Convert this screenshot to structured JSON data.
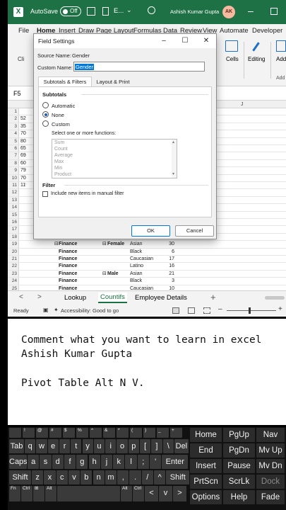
{
  "titlebar": {
    "autosave_label": "AutoSave",
    "autosave_state": "Off",
    "file_short": "E...",
    "user_name": "Ashish Kumar Gupta",
    "user_initials": "AK"
  },
  "ribbon": {
    "tabs": [
      "File",
      "Home",
      "Insert",
      "Draw",
      "Page Layout",
      "Formulas",
      "Data",
      "Review",
      "View",
      "Automate",
      "Developer"
    ],
    "active_tab": "Home",
    "clip_label": "Cli",
    "cells_label": "Cells",
    "editing_label": "Editing",
    "add_label": "Add",
    "add_group_label": "Add"
  },
  "formula_bar": {
    "cell_ref": "F5"
  },
  "grid": {
    "col_j": "J",
    "row_numbers": [
      "1",
      "2",
      "3",
      "4",
      "5",
      "6",
      "7",
      "8",
      "9",
      "10",
      "11",
      "12",
      "13",
      "14",
      "15",
      "16",
      "17",
      "18",
      "19",
      "20",
      "21",
      "22",
      "23",
      "24",
      "25"
    ],
    "left_partial": [
      "",
      "52",
      "35",
      "70",
      "80",
      "65",
      "69",
      "60",
      "79",
      "70",
      "119",
      "",
      "",
      "",
      "",
      "",
      "",
      "",
      "",
      "",
      "",
      "",
      "",
      "",
      ""
    ],
    "rows": [
      {
        "n": "19",
        "dept": "Finance",
        "gender": "Female",
        "ethnicity": "Asian",
        "count": "30",
        "dept_box": true,
        "gender_box": true
      },
      {
        "n": "20",
        "dept": "Finance",
        "gender": "",
        "ethnicity": "Black",
        "count": "6"
      },
      {
        "n": "21",
        "dept": "Finance",
        "gender": "",
        "ethnicity": "Caucasian",
        "count": "17"
      },
      {
        "n": "22",
        "dept": "Finance",
        "gender": "",
        "ethnicity": "Latino",
        "count": "16"
      },
      {
        "n": "23",
        "dept": "Finance",
        "gender": "Male",
        "ethnicity": "Asian",
        "count": "21",
        "gender_box": true
      },
      {
        "n": "24",
        "dept": "Finance",
        "gender": "",
        "ethnicity": "Black",
        "count": "3"
      },
      {
        "n": "25",
        "dept": "Finance",
        "gender": "",
        "ethnicity": "Caucasian",
        "count": "10"
      }
    ]
  },
  "sheet_tabs": {
    "items": [
      "Lookup",
      "Countifs",
      "Employee Details"
    ],
    "active": "Countifs",
    "add": "+"
  },
  "statusbar": {
    "ready": "Ready",
    "accessibility": "Accessibility: Good to go"
  },
  "dialog": {
    "title": "Field Settings",
    "source_name_label": "Source Name:",
    "source_name_value": "Gender",
    "custom_name_label": "Custom Name:",
    "custom_name_value": "Gender",
    "tab_subtotals": "Subtotals & Filters",
    "tab_layout": "Layout & Print",
    "subtotals_heading": "Subtotals",
    "opt_automatic": "Automatic",
    "opt_none": "None",
    "opt_custom": "Custom",
    "selected_option": "None",
    "functions_label": "Select one or more functions:",
    "functions": [
      "Sum",
      "Count",
      "Average",
      "Max",
      "Min",
      "Product"
    ],
    "filter_heading": "Filter",
    "include_new_items": "Include new items in manual filter",
    "ok": "OK",
    "cancel": "Cancel"
  },
  "notes": {
    "line1": "Comment what you want to learn in excel",
    "line2": "Ashish Kumar Gupta",
    "line3": "Pivot Table Alt N V."
  },
  "keyboard": {
    "row1_small": [
      "",
      "!",
      "@",
      "#",
      "$",
      "%",
      "^",
      "&",
      "*",
      "(",
      ")",
      "_",
      "+"
    ],
    "row2": [
      "Tab",
      "q",
      "w",
      "e",
      "r",
      "t",
      "y",
      "u",
      "i",
      "o",
      "p",
      "[",
      "]",
      "\\",
      "Del"
    ],
    "row3": [
      "Caps",
      "a",
      "s",
      "d",
      "f",
      "g",
      "h",
      "j",
      "k",
      "l",
      ";",
      "'",
      "Enter"
    ],
    "row4": [
      "Shift",
      "z",
      "x",
      "c",
      "v",
      "b",
      "n",
      "m",
      ",",
      ".",
      "/",
      "^",
      "Shift"
    ],
    "row5": [
      "Fn",
      "Ctrl",
      "⊞",
      "Alt",
      "",
      "Alt",
      "Ctrl",
      "<",
      "v",
      ">"
    ],
    "nav": [
      [
        "Home",
        "PgUp",
        "Nav"
      ],
      [
        "End",
        "PgDn",
        "Mv Up"
      ],
      [
        "Insert",
        "Pause",
        "Mv Dn"
      ],
      [
        "PrtScn",
        "ScrLk",
        "Dock"
      ],
      [
        "Options",
        "Help",
        "Fade"
      ]
    ]
  }
}
